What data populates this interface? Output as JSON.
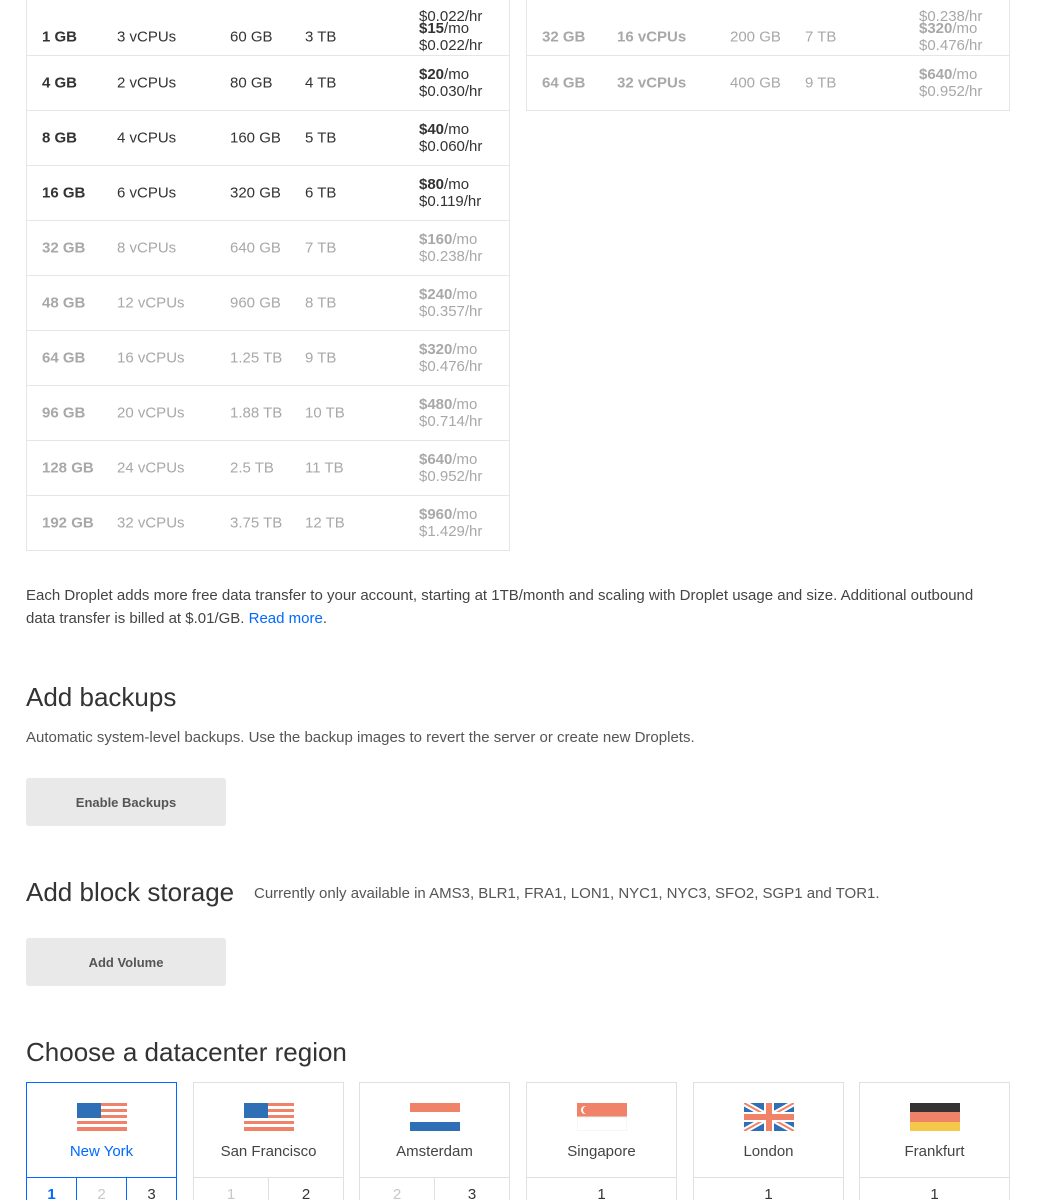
{
  "pricing_left": {
    "partial_price_hr": "$0.022/hr",
    "rows": [
      {
        "memory": "1 GB",
        "cpus": "3 vCPUs",
        "ssd": "60 GB",
        "transfer": "3 TB",
        "price_mo": "$15",
        "mo_unit": "/mo",
        "price_hr": "$0.022/hr",
        "available": true
      },
      {
        "memory": "4 GB",
        "cpus": "2 vCPUs",
        "ssd": "80 GB",
        "transfer": "4 TB",
        "price_mo": "$20",
        "mo_unit": "/mo",
        "price_hr": "$0.030/hr",
        "available": true
      },
      {
        "memory": "8 GB",
        "cpus": "4 vCPUs",
        "ssd": "160 GB",
        "transfer": "5 TB",
        "price_mo": "$40",
        "mo_unit": "/mo",
        "price_hr": "$0.060/hr",
        "available": true
      },
      {
        "memory": "16 GB",
        "cpus": "6 vCPUs",
        "ssd": "320 GB",
        "transfer": "6 TB",
        "price_mo": "$80",
        "mo_unit": "/mo",
        "price_hr": "$0.119/hr",
        "available": true
      },
      {
        "memory": "32 GB",
        "cpus": "8 vCPUs",
        "ssd": "640 GB",
        "transfer": "7 TB",
        "price_mo": "$160",
        "mo_unit": "/mo",
        "price_hr": "$0.238/hr",
        "available": false
      },
      {
        "memory": "48 GB",
        "cpus": "12 vCPUs",
        "ssd": "960 GB",
        "transfer": "8 TB",
        "price_mo": "$240",
        "mo_unit": "/mo",
        "price_hr": "$0.357/hr",
        "available": false
      },
      {
        "memory": "64 GB",
        "cpus": "16 vCPUs",
        "ssd": "1.25 TB",
        "transfer": "9 TB",
        "price_mo": "$320",
        "mo_unit": "/mo",
        "price_hr": "$0.476/hr",
        "available": false
      },
      {
        "memory": "96 GB",
        "cpus": "20 vCPUs",
        "ssd": "1.88 TB",
        "transfer": "10 TB",
        "price_mo": "$480",
        "mo_unit": "/mo",
        "price_hr": "$0.714/hr",
        "available": false
      },
      {
        "memory": "128 GB",
        "cpus": "24 vCPUs",
        "ssd": "2.5 TB",
        "transfer": "11 TB",
        "price_mo": "$640",
        "mo_unit": "/mo",
        "price_hr": "$0.952/hr",
        "available": false
      },
      {
        "memory": "192 GB",
        "cpus": "32 vCPUs",
        "ssd": "3.75 TB",
        "transfer": "12 TB",
        "price_mo": "$960",
        "mo_unit": "/mo",
        "price_hr": "$1.429/hr",
        "available": false
      }
    ]
  },
  "pricing_right": {
    "partial_price_hr": "$0.238/hr",
    "rows": [
      {
        "memory": "32 GB",
        "cpus": "16 vCPUs",
        "ssd": "200 GB",
        "transfer": "7 TB",
        "price_mo": "$320",
        "mo_unit": "/mo",
        "price_hr": "$0.476/hr",
        "available": false
      },
      {
        "memory": "64 GB",
        "cpus": "32 vCPUs",
        "ssd": "400 GB",
        "transfer": "9 TB",
        "price_mo": "$640",
        "mo_unit": "/mo",
        "price_hr": "$0.952/hr",
        "available": false
      }
    ]
  },
  "transfer_note": {
    "text": "Each Droplet adds more free data transfer to your account, starting at 1TB/month and scaling with Droplet usage and size. Additional outbound data transfer is billed at $.01/GB.",
    "link": "Read more",
    "end": "."
  },
  "backups": {
    "title": "Add backups",
    "description": "Automatic system-level backups. Use the backup images to revert the server or create new Droplets.",
    "button": "Enable Backups"
  },
  "block_storage": {
    "title": "Add block storage",
    "availability": "Currently only available in AMS3, BLR1, FRA1, LON1, NYC1, NYC3, SFO2, SGP1 and TOR1.",
    "button": "Add Volume"
  },
  "datacenter": {
    "title": "Choose a datacenter region",
    "regions": [
      {
        "name": "New York",
        "flag": "us-flag-icon",
        "selected": true,
        "numbers": [
          {
            "n": "1",
            "state": "active"
          },
          {
            "n": "2",
            "state": "dim"
          },
          {
            "n": "3",
            "state": "normal"
          }
        ]
      },
      {
        "name": "San Francisco",
        "flag": "us-flag-icon",
        "selected": false,
        "numbers": [
          {
            "n": "1",
            "state": "dim"
          },
          {
            "n": "2",
            "state": "normal"
          }
        ]
      },
      {
        "name": "Amsterdam",
        "flag": "nl-flag-icon",
        "selected": false,
        "numbers": [
          {
            "n": "2",
            "state": "dim"
          },
          {
            "n": "3",
            "state": "normal"
          }
        ]
      },
      {
        "name": "Singapore",
        "flag": "sg-flag-icon",
        "selected": false,
        "numbers": [
          {
            "n": "1",
            "state": "normal"
          }
        ]
      },
      {
        "name": "London",
        "flag": "uk-flag-icon",
        "selected": false,
        "numbers": [
          {
            "n": "1",
            "state": "normal"
          }
        ]
      },
      {
        "name": "Frankfurt",
        "flag": "de-flag-icon",
        "selected": false,
        "numbers": [
          {
            "n": "1",
            "state": "normal"
          }
        ]
      }
    ]
  },
  "colors": {
    "accent": "#0069ff",
    "muted": "#a8a8a8",
    "button_bg": "#e9e9e9"
  }
}
